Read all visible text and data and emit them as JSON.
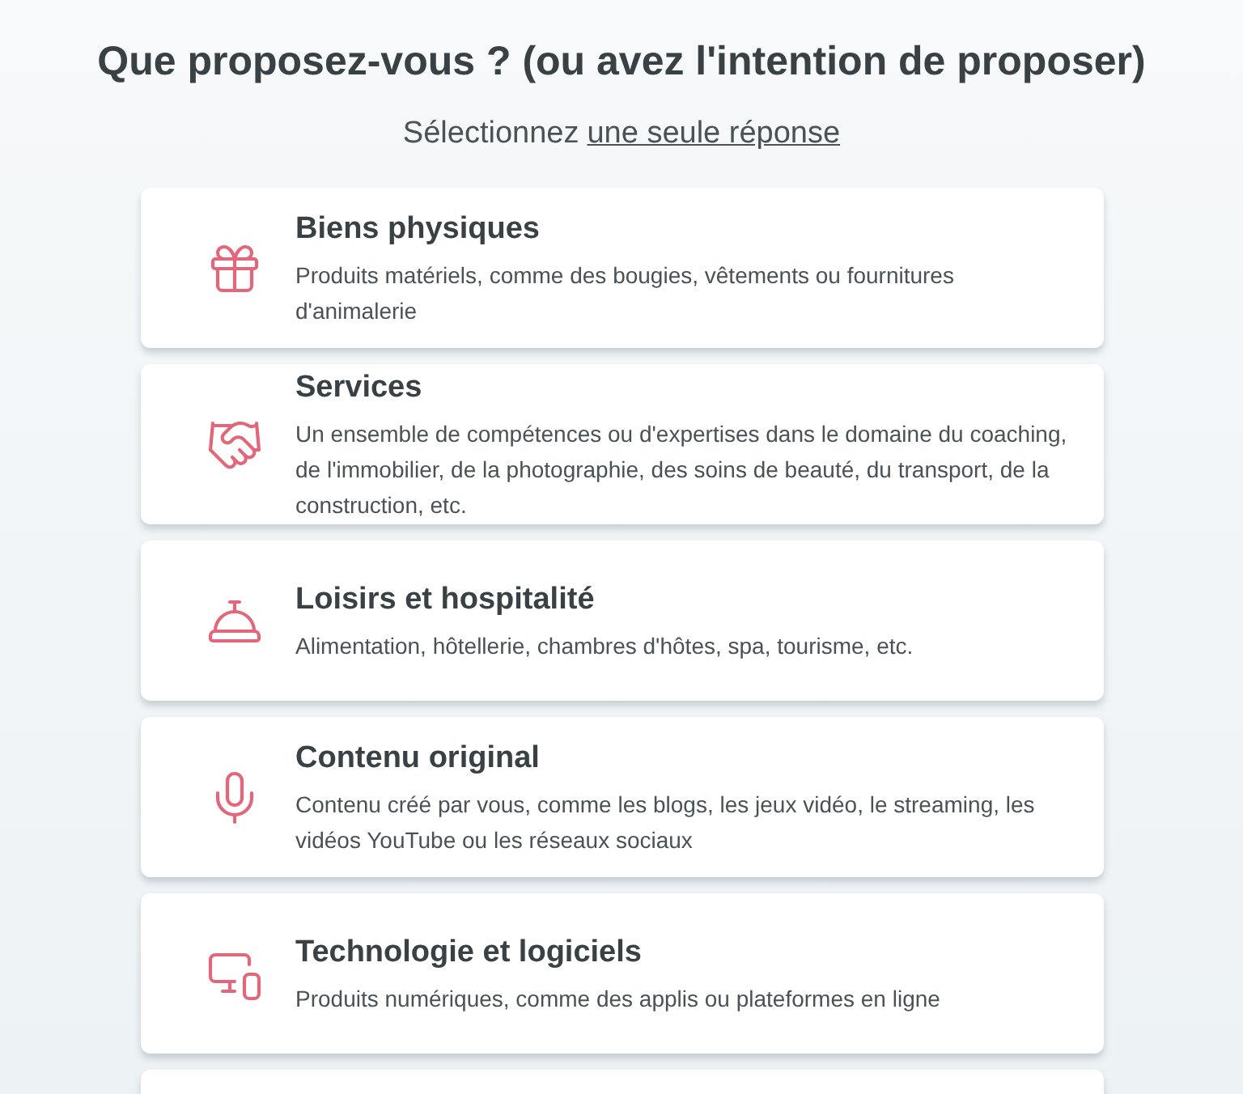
{
  "heading": "Que proposez-vous ? (ou avez l'intention de proposer)",
  "subtitle": {
    "text": "Sélectionnez",
    "link": "une seule réponse"
  },
  "options": [
    {
      "kind": "gift",
      "title": "Biens physiques",
      "description": "Produits matériels, comme des bougies, vêtements ou fournitures d'animalerie"
    },
    {
      "kind": "handshake",
      "title": "Services",
      "description": "Un ensemble de compétences ou d'expertises dans le domaine du coaching, de l'immobilier, de la photographie, des soins de beauté, du transport, de la construction, etc."
    },
    {
      "kind": "bell",
      "title": "Loisirs et hospitalité",
      "description": "Alimentation, hôtellerie, chambres d'hôtes, spa, tourisme, etc."
    },
    {
      "kind": "mic",
      "title": "Contenu original",
      "description": "Contenu créé par vous, comme les blogs, les jeux vidéo, le streaming, les vidéos YouTube ou les réseaux sociaux"
    },
    {
      "kind": "devices",
      "title": "Technologie et logiciels",
      "description": "Produits numériques, comme des applis ou plateformes en ligne"
    }
  ]
}
